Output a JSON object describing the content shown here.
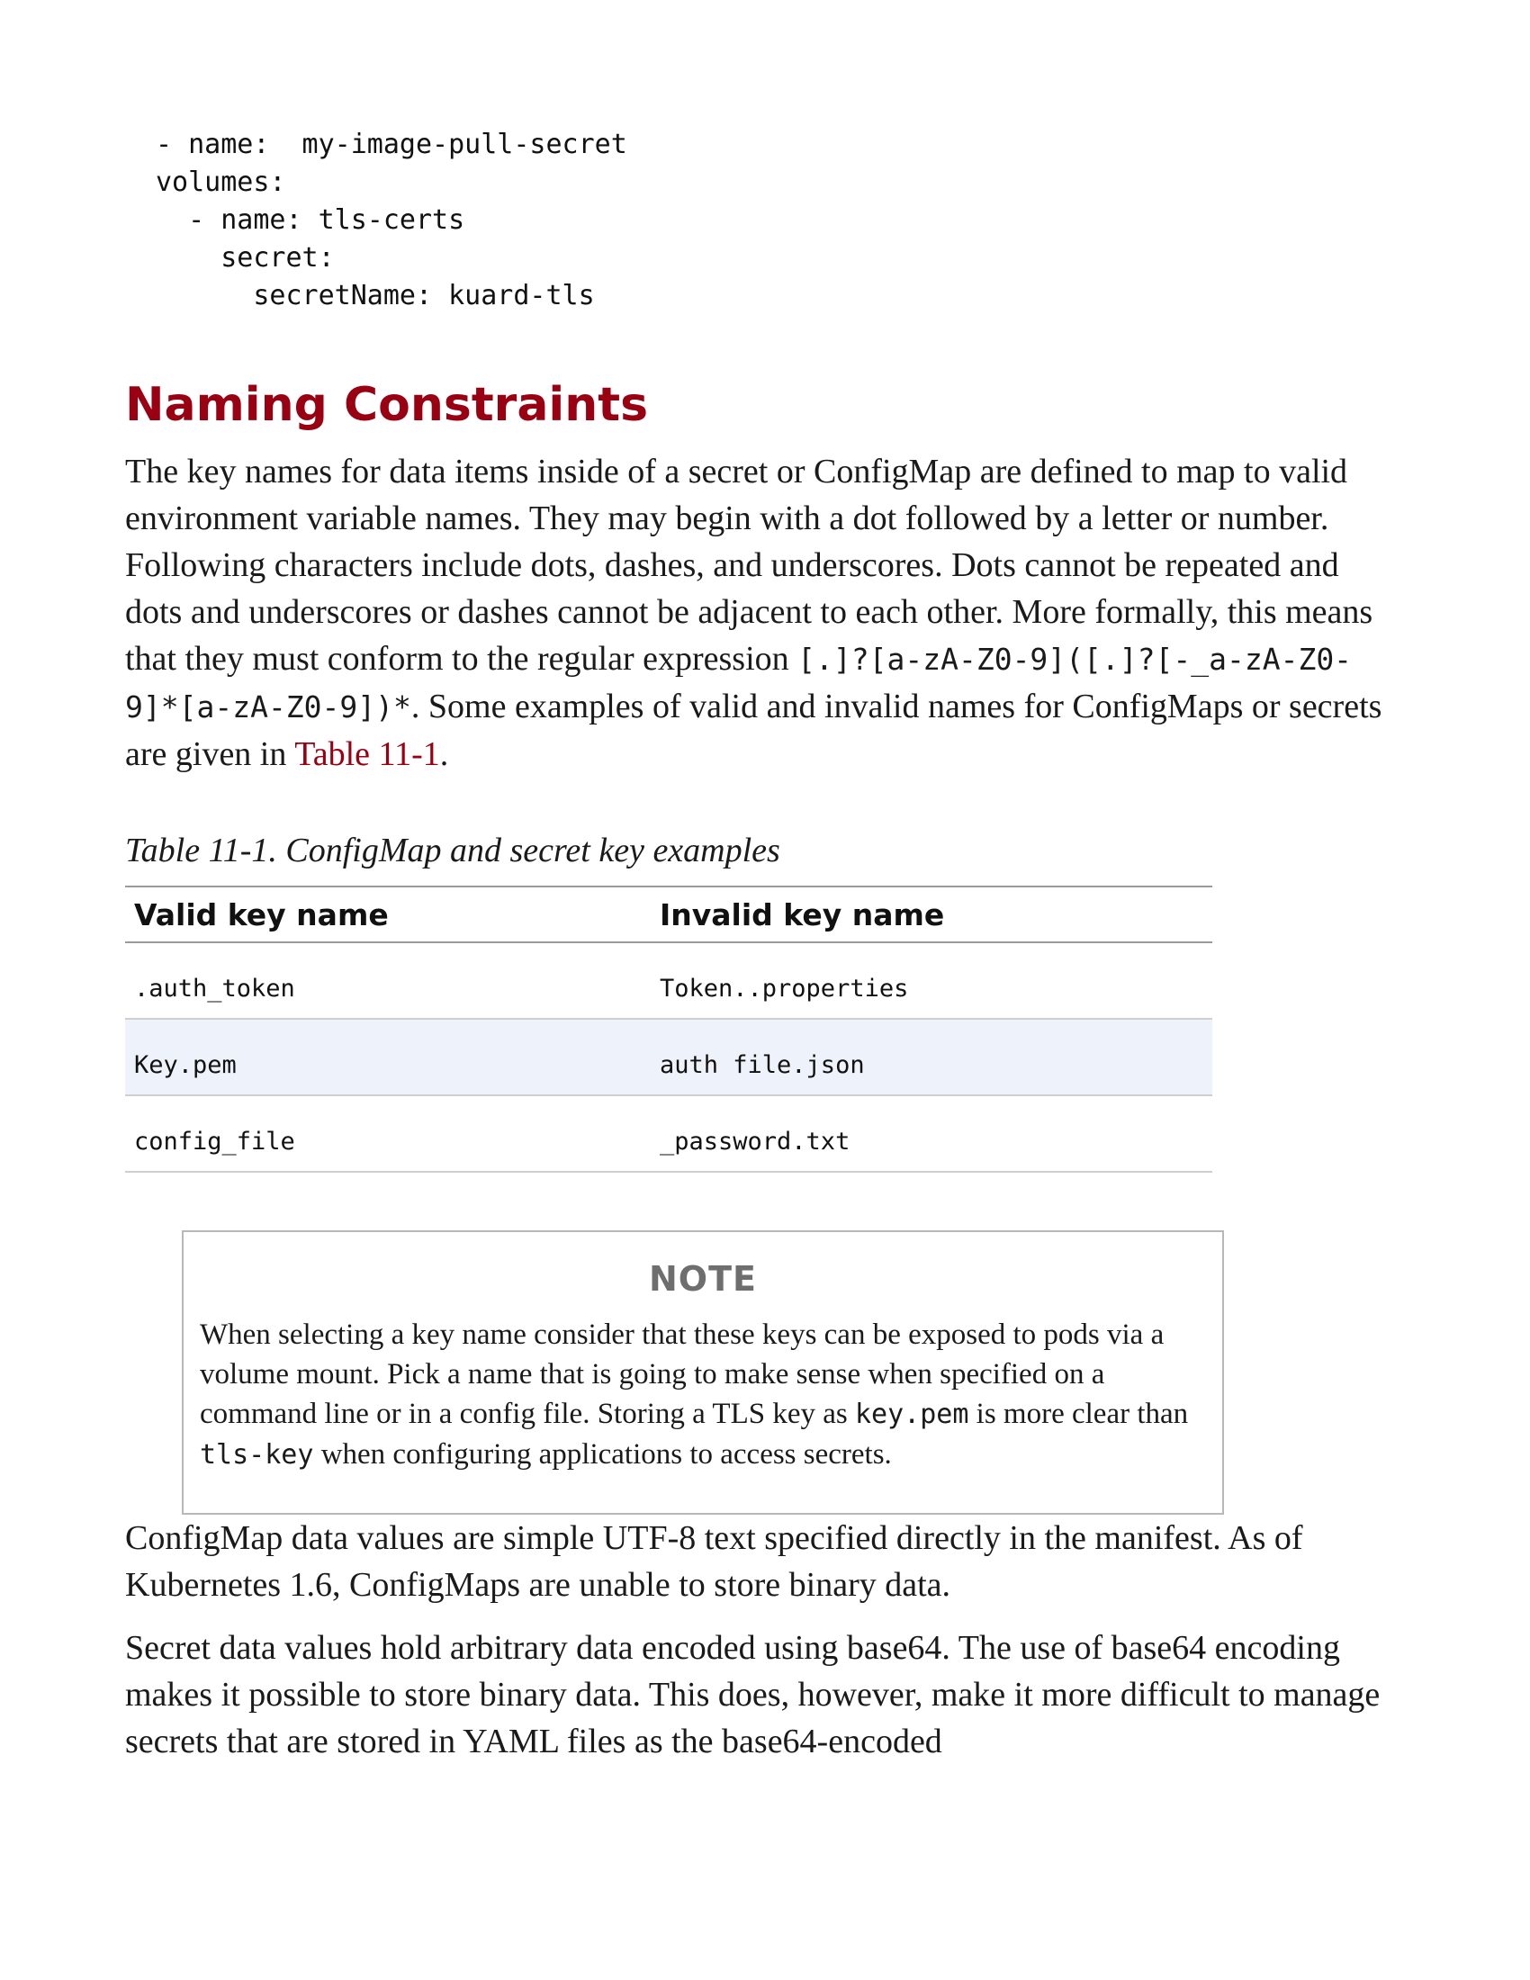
{
  "code_block": {
    "lines": [
      "- name:  my-image-pull-secret",
      "volumes:",
      "  - name: tls-certs",
      "    secret:",
      "      secretName: kuard-tls"
    ]
  },
  "section": {
    "heading": "Naming Constraints",
    "para1": {
      "text_a": "The key names for data items inside of a secret or ConfigMap are defined to map to valid environment variable names. They may begin with a dot followed by a letter or number. Following characters include dots, dashes, and underscores. Dots cannot be repeated and dots and underscores or dashes cannot be adjacent to each other. More formally, this means that they must conform to the regular expression ",
      "regex": "[.]?[a-zA-Z0-9]([.]?[-_a-zA-Z0-9]*[a-zA-Z0-9])*",
      "text_b": ". Some examples of valid and invalid names for ConfigMaps or secrets are given in ",
      "xref": "Table 11-1",
      "text_c": "."
    }
  },
  "table": {
    "caption": "Table 11-1. ConfigMap and secret key examples",
    "headers": [
      "Valid key name",
      "Invalid key name"
    ],
    "rows": [
      [
        ".auth_token",
        "Token..properties"
      ],
      [
        "Key.pem",
        "auth file.json"
      ],
      [
        "config_file",
        "_password.txt"
      ]
    ]
  },
  "note": {
    "title": "NOTE",
    "text_a": "When selecting a key name consider that these keys can be exposed to pods via a volume mount. Pick a name that is going to make sense when specified on a command line or in a config file. Storing a TLS key as ",
    "code1": "key.pem",
    "text_b": " is more clear than ",
    "code2": "tls-key",
    "text_c": " when configuring applications to access secrets."
  },
  "para2": "ConfigMap data values are simple UTF-8 text specified directly in the manifest. As of Kubernetes 1.6, ConfigMaps are unable to store binary data.",
  "para3": "Secret data values hold arbitrary data encoded using base64. The use of base64 encoding makes it possible to store binary data. This does, however, make it more difficult to manage secrets that are stored in YAML files as the base64-encoded"
}
